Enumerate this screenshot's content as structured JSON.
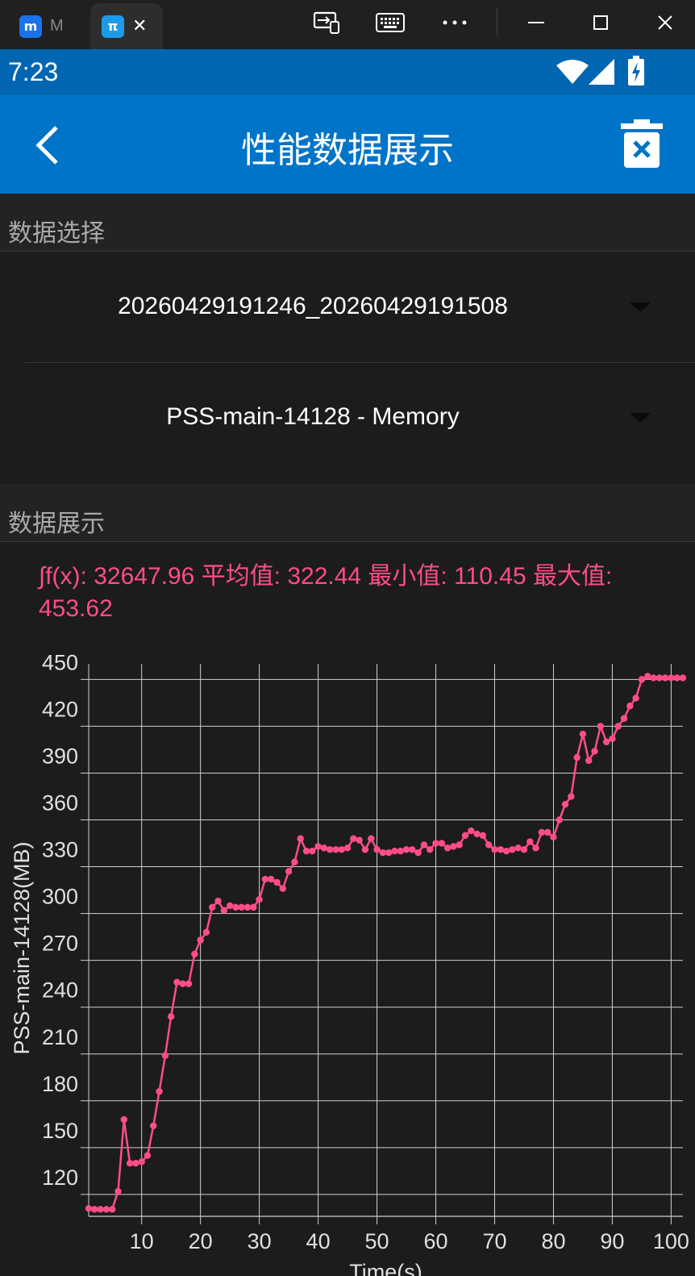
{
  "window": {
    "tab1": {
      "label": "M"
    },
    "tab2": {
      "close": "✕"
    }
  },
  "statusbar": {
    "time": "7:23"
  },
  "appbar": {
    "title": "性能数据展示"
  },
  "data_select": {
    "header": "数据选择",
    "session_value": "20260429191246_20260429191508",
    "metric_value": "PSS-main-14128 - Memory"
  },
  "data_display": {
    "header": "数据展示",
    "stats_text": "∫f(x): 32647.96 平均值: 322.44 最小值: 110.45 最大值: 453.62"
  },
  "chart_data": {
    "type": "line",
    "xlabel": "Time(s)",
    "ylabel": "PSS-main-14128(MB)",
    "xlim": [
      1,
      102
    ],
    "ylim": [
      106,
      460
    ],
    "x_ticks": [
      10,
      20,
      30,
      40,
      50,
      60,
      70,
      80,
      90,
      100
    ],
    "y_ticks": [
      120,
      150,
      180,
      210,
      240,
      270,
      300,
      330,
      360,
      390,
      420,
      450
    ],
    "grid": true,
    "color": "#ff4d88",
    "series": [
      {
        "x": [
          1,
          2,
          3,
          4,
          5,
          6,
          7,
          8,
          9,
          10,
          11,
          12,
          13,
          14,
          15,
          16,
          17,
          18,
          19,
          20,
          21,
          22,
          23,
          24,
          25,
          26,
          27,
          28,
          29,
          30,
          31,
          32,
          33,
          34,
          35,
          36,
          37,
          38,
          39,
          40,
          41,
          42,
          43,
          44,
          45,
          46,
          47,
          48,
          49,
          50,
          51,
          52,
          53,
          54,
          55,
          56,
          57,
          58,
          59,
          60,
          61,
          62,
          63,
          64,
          65,
          66,
          67,
          68,
          69,
          70,
          71,
          72,
          73,
          74,
          75,
          76,
          77,
          78,
          79,
          80,
          81,
          82,
          83,
          84,
          85,
          86,
          87,
          88,
          89,
          90,
          91,
          92,
          93,
          94,
          95,
          96,
          97,
          98,
          99,
          100,
          101,
          102
        ],
        "values": [
          111,
          110.5,
          110.5,
          110.5,
          110.5,
          122,
          168,
          140,
          140,
          141,
          145,
          164,
          186,
          209,
          234,
          256,
          255,
          255,
          274,
          283,
          288,
          304,
          308,
          302,
          305,
          304,
          304,
          304,
          304,
          309,
          322,
          322,
          320,
          316,
          327,
          333,
          348,
          340,
          340,
          343,
          342,
          341,
          341,
          341,
          342,
          348,
          347,
          341,
          348,
          341,
          339,
          339,
          340,
          340,
          341,
          341,
          339,
          344,
          341,
          345,
          345,
          342,
          343,
          344,
          350,
          353,
          351,
          350,
          344,
          341,
          341,
          340,
          341,
          342,
          341,
          346,
          342,
          352,
          352,
          349,
          360,
          370,
          375,
          400,
          415,
          398,
          404,
          420,
          410,
          412,
          420,
          425,
          433,
          438,
          450,
          452,
          451,
          451,
          451,
          451,
          451,
          451
        ]
      }
    ]
  }
}
